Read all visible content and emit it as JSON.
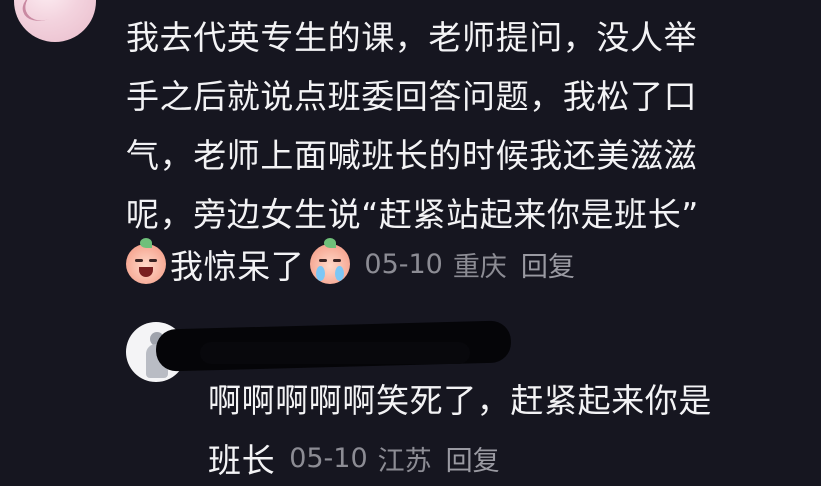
{
  "comment": {
    "lines": [
      "我去代英专生的课，老师提问，没人举",
      "手之后就说点班委回答问题，我松了口",
      "气，老师上面喊班长的时候我还美滋滋",
      "呢，旁边女生说“赶紧站起来你是班长”"
    ],
    "shock_text": "我惊呆了",
    "date": "05-10",
    "location": "重庆",
    "reply_label": "回复"
  },
  "reply": {
    "line1": "啊啊啊啊啊笑死了，赶紧起来你是",
    "line2": "班长",
    "date": "05-10",
    "location": "江苏",
    "reply_label": "回复"
  },
  "icons": {
    "emoji_1": "scream-peach-emoji-icon",
    "emoji_2": "crying-peach-emoji-icon"
  },
  "colors": {
    "background": "#161620",
    "text": "#f3f3f5",
    "meta": "#8c8c94"
  }
}
